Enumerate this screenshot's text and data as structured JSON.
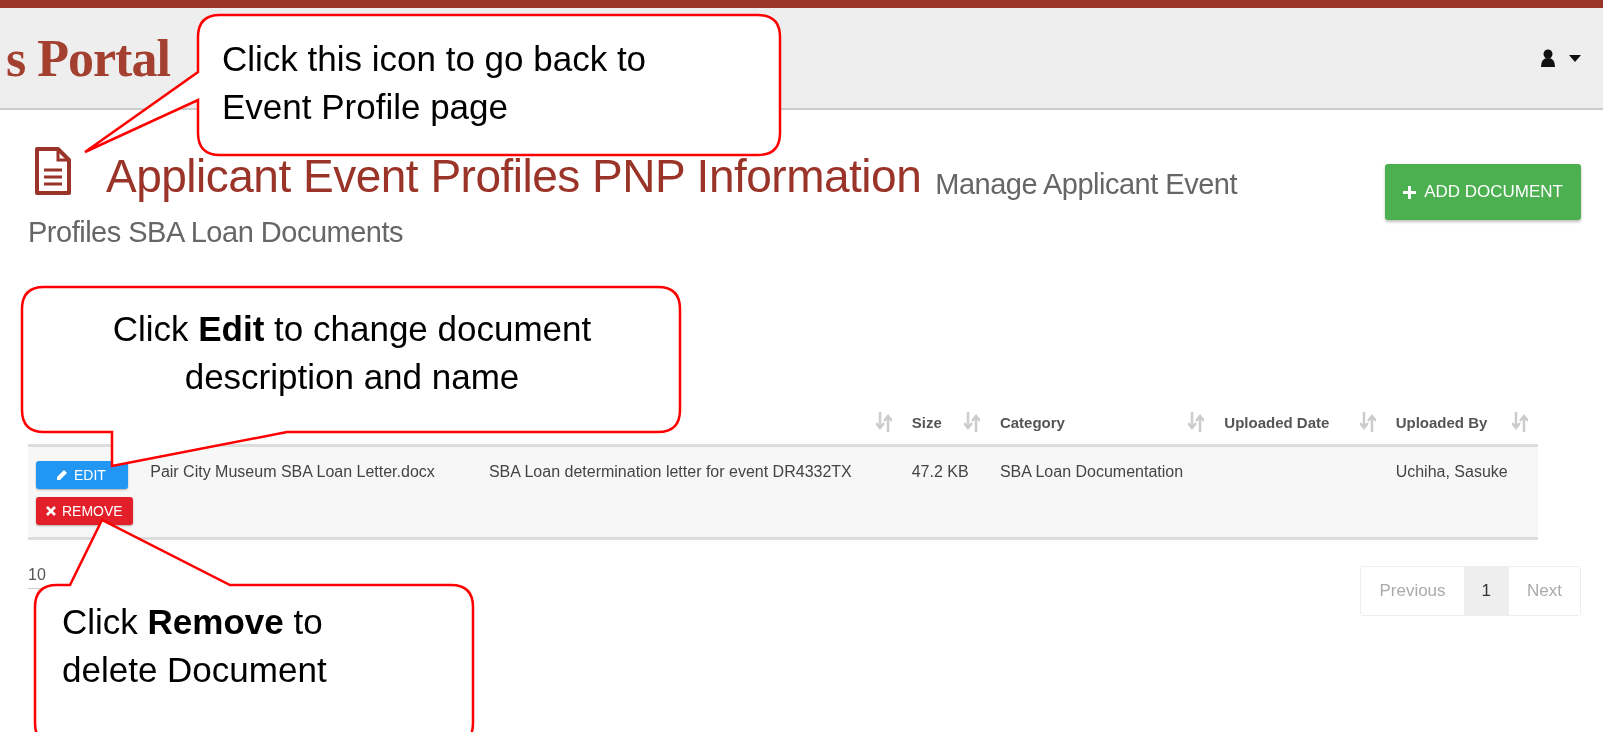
{
  "header": {
    "logo": "s Portal"
  },
  "page": {
    "title": "Applicant Event Profiles PNP Information",
    "subtitle_lines": [
      "Manage Applicant Event",
      "Profiles SBA Loan Documents"
    ],
    "add_button": "ADD DOCUMENT"
  },
  "table": {
    "columns": [
      {
        "label": "Size"
      },
      {
        "label": "Category"
      },
      {
        "label": "Uploaded Date"
      },
      {
        "label": "Uploaded By"
      }
    ],
    "rows": [
      {
        "actions": [
          {
            "kind": "edit",
            "label": "EDIT"
          },
          {
            "kind": "remove",
            "label": "REMOVE"
          }
        ],
        "file_name": "Pair City Museum SBA Loan Letter.docx",
        "description": "SBA Loan determination letter for event DR4332TX",
        "size": "47.2 KB",
        "category": "SBA Loan Documentation",
        "uploaded_by": "Uchiha, Sasuke"
      }
    ]
  },
  "footer": {
    "page_length": "10",
    "pagination": [
      {
        "label": "Previous",
        "selected": false,
        "disabled": true
      },
      {
        "label": "1",
        "selected": true,
        "disabled": false
      },
      {
        "label": "Next",
        "selected": false,
        "disabled": true
      }
    ]
  },
  "callouts": [
    {
      "text": "Click this icon to go back to Event Profile page"
    },
    {
      "text": "Click **Edit** to change document description and name"
    },
    {
      "text": "Click **Remove** to delete Document"
    }
  ]
}
